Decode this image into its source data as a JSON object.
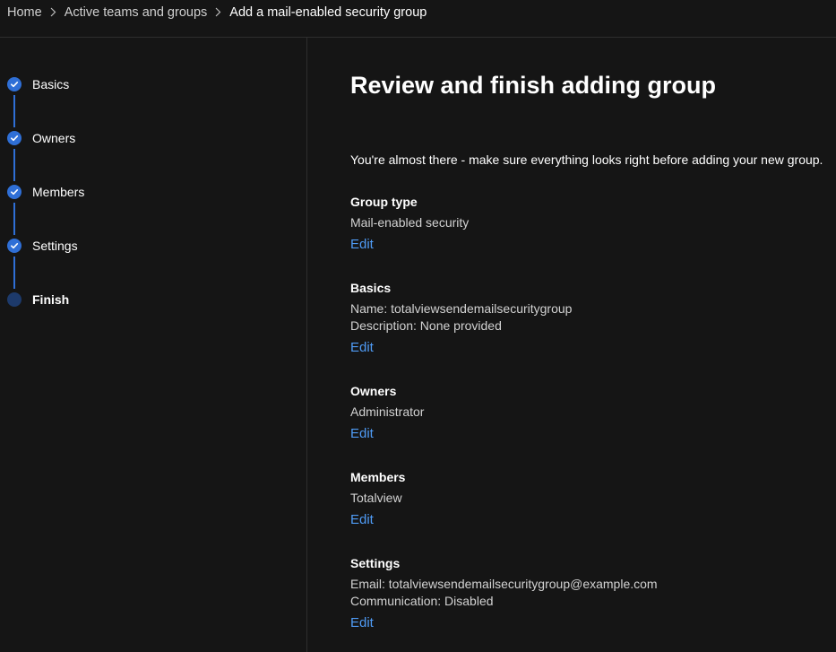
{
  "breadcrumb": {
    "items": [
      {
        "label": "Home"
      },
      {
        "label": "Active teams and groups"
      },
      {
        "label": "Add a mail-enabled security group"
      }
    ]
  },
  "wizard": {
    "steps": [
      {
        "label": "Basics",
        "status": "completed"
      },
      {
        "label": "Owners",
        "status": "completed"
      },
      {
        "label": "Members",
        "status": "completed"
      },
      {
        "label": "Settings",
        "status": "completed"
      },
      {
        "label": "Finish",
        "status": "current"
      }
    ]
  },
  "main": {
    "title": "Review and finish adding group",
    "intro": "You're almost there - make sure everything looks right before adding your new group.",
    "sections": [
      {
        "title": "Group type",
        "lines": [
          "Mail-enabled security"
        ],
        "edit_label": "Edit"
      },
      {
        "title": "Basics",
        "lines": [
          "Name: totalviewsendemailsecuritygroup",
          "Description: None provided"
        ],
        "edit_label": "Edit"
      },
      {
        "title": "Owners",
        "lines": [
          "Administrator"
        ],
        "edit_label": "Edit"
      },
      {
        "title": "Members",
        "lines": [
          "Totalview"
        ],
        "edit_label": "Edit"
      },
      {
        "title": "Settings",
        "lines": [
          "Email: totalviewsendemailsecuritygroup@example.com",
          "Communication: Disabled"
        ],
        "edit_label": "Edit"
      }
    ]
  },
  "colors": {
    "background": "#151515",
    "accent": "#2f6fd6",
    "link": "#4f9bf5",
    "divider": "#2e2e2e"
  },
  "icons": {
    "breadcrumb_separator": "chevron-right-icon",
    "completed_step": "checkmark-icon"
  }
}
